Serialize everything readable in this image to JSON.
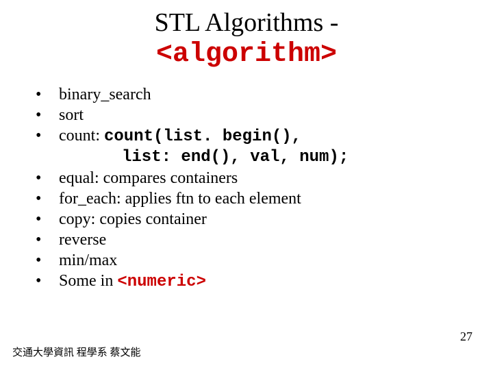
{
  "title": {
    "line1": "STL Algorithms -",
    "line2": "<algorithm>"
  },
  "bullets": {
    "b1": "binary_search",
    "b2": "sort",
    "b3_prefix": "count: ",
    "b3_code1": "count(list. begin(),",
    "b3_code2": "list: end(), val, num);",
    "b4": "equal: compares containers",
    "b5": "for_each: applies ftn to each element",
    "b6": "copy: copies container",
    "b7": "reverse",
    "b8": "min/max",
    "b9_prefix": "Some in ",
    "b9_code": "<numeric>"
  },
  "footer": {
    "left": "交通大學資訊 程學系 蔡文能",
    "page": "27"
  },
  "dot": "•"
}
